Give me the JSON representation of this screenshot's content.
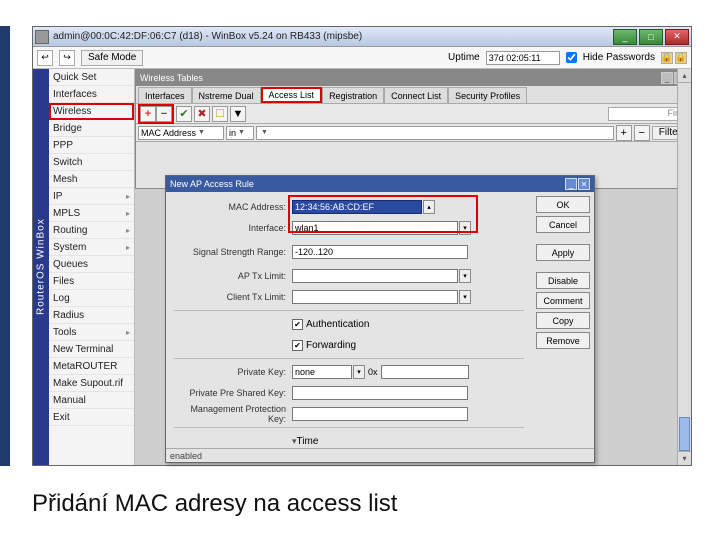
{
  "window": {
    "title": "admin@00:0C:42:DF:06:C7 (d18) - WinBox v5.24 on RB433 (mipsbe)",
    "safe_mode": "Safe Mode",
    "uptime_label": "Uptime",
    "uptime_value": "37d 02:05:11",
    "hide_pw": "Hide Passwords"
  },
  "brand": "RouterOS WinBox",
  "sidebar": {
    "items": [
      {
        "label": "Quick Set",
        "arrow": false
      },
      {
        "label": "Interfaces",
        "arrow": false
      },
      {
        "label": "Wireless",
        "arrow": false,
        "hi": true
      },
      {
        "label": "Bridge",
        "arrow": false
      },
      {
        "label": "PPP",
        "arrow": false
      },
      {
        "label": "Switch",
        "arrow": false
      },
      {
        "label": "Mesh",
        "arrow": false
      },
      {
        "label": "IP",
        "arrow": true
      },
      {
        "label": "MPLS",
        "arrow": true
      },
      {
        "label": "Routing",
        "arrow": true
      },
      {
        "label": "System",
        "arrow": true
      },
      {
        "label": "Queues",
        "arrow": false
      },
      {
        "label": "Files",
        "arrow": false
      },
      {
        "label": "Log",
        "arrow": false
      },
      {
        "label": "Radius",
        "arrow": false
      },
      {
        "label": "Tools",
        "arrow": true
      },
      {
        "label": "New Terminal",
        "arrow": false
      },
      {
        "label": "MetaROUTER",
        "arrow": false
      },
      {
        "label": "Make Supout.rif",
        "arrow": false
      },
      {
        "label": "Manual",
        "arrow": false
      },
      {
        "label": "Exit",
        "arrow": false
      }
    ]
  },
  "wt": {
    "title": "Wireless Tables",
    "tabs": [
      "Interfaces",
      "Nstreme Dual",
      "Access List",
      "Registration",
      "Connect List",
      "Security Profiles"
    ],
    "active_tab_index": 2,
    "toolbar_icons": [
      "+",
      "−",
      "✔",
      "✖",
      "☐",
      "▼"
    ],
    "find_placeholder": "Find",
    "filter_field": "MAC Address",
    "filter_op": "in",
    "filter_btn": "Filter"
  },
  "ap": {
    "title": "New AP Access Rule",
    "fields": {
      "mac_label": "MAC Address:",
      "mac_value": "12:34:56:AB:CD:EF",
      "iface_label": "Interface:",
      "iface_value": "wlan1",
      "ssr_label": "Signal Strength Range:",
      "ssr_value": "-120..120",
      "aptx_label": "AP Tx Limit:",
      "aptx_value": "",
      "cltx_label": "Client Tx Limit:",
      "cltx_value": "",
      "auth_label": "Authentication",
      "auth_checked": true,
      "fwd_label": "Forwarding",
      "fwd_checked": true,
      "pk_label": "Private Key:",
      "pk_value": "none",
      "pk_extra": "0x",
      "ppsk_label": "Private Pre Shared Key:",
      "ppsk_value": "",
      "mpk_label": "Management Protection Key:",
      "mpk_value": "",
      "time_label": "Time"
    },
    "buttons": [
      "OK",
      "Cancel",
      "Apply",
      "Disable",
      "Comment",
      "Copy",
      "Remove"
    ],
    "status": "enabled"
  },
  "caption": "Přidání MAC adresy na access list"
}
